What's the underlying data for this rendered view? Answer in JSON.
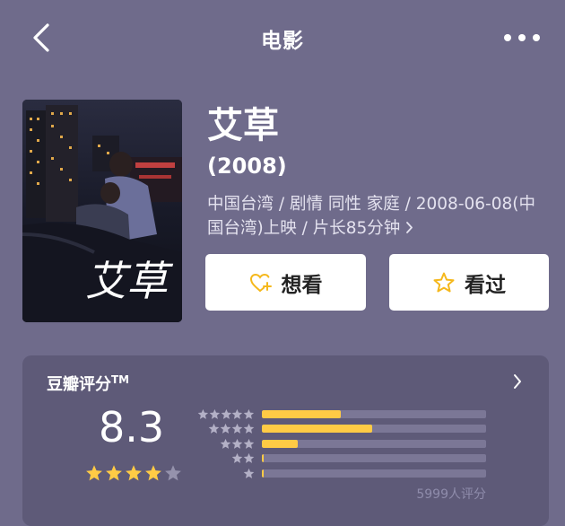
{
  "header": {
    "title": "电影"
  },
  "movie": {
    "title": "艾草",
    "year": "(2008)",
    "meta": "中国台湾 / 剧情 同性 家庭 / 2008-06-08(中国台湾)上映 / 片长85分钟",
    "poster_text": "艾草"
  },
  "actions": {
    "want_label": "想看",
    "watched_label": "看过"
  },
  "rating": {
    "title": "豆瓣评分",
    "trademark": "TM",
    "score": "8.3",
    "stars_filled": 4,
    "stars_total": 5,
    "distribution": [
      {
        "stars": 5,
        "fraction": 0.35
      },
      {
        "stars": 4,
        "fraction": 0.49
      },
      {
        "stars": 3,
        "fraction": 0.16
      },
      {
        "stars": 2,
        "fraction": 0.005
      },
      {
        "stars": 1,
        "fraction": 0.005
      }
    ],
    "vote_count": "5999人评分"
  },
  "colors": {
    "background": "#6f6b8b",
    "card": "#5e5a78",
    "accent_star": "#ffcb45",
    "track": "#7b7796"
  },
  "icons": {
    "back": "chevron-left-icon",
    "more": "more-dots-icon",
    "want": "heart-plus-icon",
    "watched": "star-outline-icon"
  }
}
